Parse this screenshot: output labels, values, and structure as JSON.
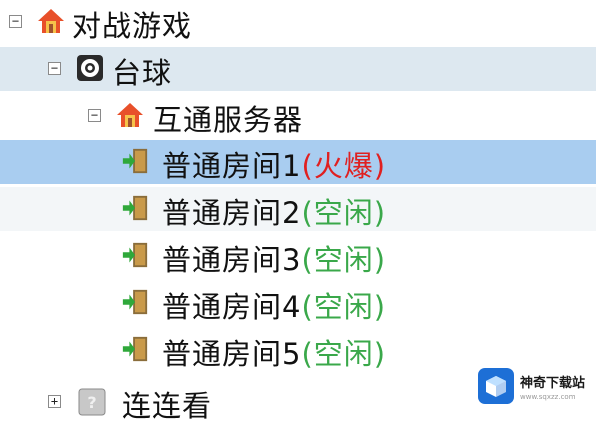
{
  "tree": {
    "root": {
      "label": "对战游戏",
      "toggle": "−",
      "icon": "house-icon"
    },
    "category": {
      "label": "台球",
      "toggle": "−",
      "icon": "billiard-ball-icon"
    },
    "server": {
      "label": "互通服务器",
      "toggle": "−",
      "icon": "house-icon"
    },
    "rooms": [
      {
        "label": "普通房间1",
        "status": "(火爆)",
        "state": "hot"
      },
      {
        "label": "普通房间2",
        "status": "(空闲)",
        "state": "idle"
      },
      {
        "label": "普通房间3",
        "status": "(空闲)",
        "state": "idle"
      },
      {
        "label": "普通房间4",
        "status": "(空闲)",
        "state": "idle"
      },
      {
        "label": "普通房间5",
        "status": "(空闲)",
        "state": "idle"
      }
    ],
    "collapsed_category": {
      "label": "连连看",
      "toggle": "+",
      "icon": "unknown-game-icon"
    },
    "selected_room_index": 0
  },
  "watermark": {
    "title": "神奇下载站",
    "subtitle": "www.sqxzz.com"
  },
  "colors": {
    "selected_row": "#a9cdf0",
    "group_row": "#dde8f0",
    "status_hot": "#e02020",
    "status_idle": "#3aa84a"
  }
}
